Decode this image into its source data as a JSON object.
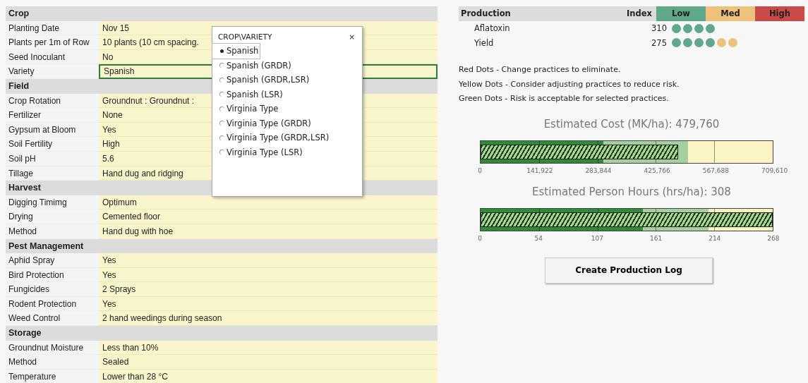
{
  "sections": [
    {
      "title": "Crop",
      "rows": [
        {
          "label": "Planting Date",
          "value": "Nov 15",
          "selected": false
        },
        {
          "label": "Plants per 1m of Row",
          "value": "10 plants (10 cm spacing.",
          "selected": false
        },
        {
          "label": "Seed Inoculant",
          "value": "No",
          "selected": false
        },
        {
          "label": "Variety",
          "value": "Spanish",
          "selected": true
        }
      ]
    },
    {
      "title": "Field",
      "rows": [
        {
          "label": "Crop Rotation",
          "value": "Groundnut : Groundnut :",
          "selected": false
        },
        {
          "label": "Fertilizer",
          "value": "None",
          "selected": false
        },
        {
          "label": "Gypsum at Bloom",
          "value": "Yes",
          "selected": false
        },
        {
          "label": "Soil Fertility",
          "value": "High",
          "selected": false
        },
        {
          "label": "Soil pH",
          "value": "5.6",
          "selected": false
        },
        {
          "label": "Tillage",
          "value": "Hand dug and ridging",
          "selected": false
        }
      ]
    },
    {
      "title": "Harvest",
      "rows": [
        {
          "label": "Digging Timimg",
          "value": "Optimum",
          "selected": false
        },
        {
          "label": "Drying",
          "value": "Cemented floor",
          "selected": false
        },
        {
          "label": "Method",
          "value": "Hand dug with hoe",
          "selected": false
        }
      ]
    },
    {
      "title": "Pest Management",
      "rows": [
        {
          "label": "Aphid Spray",
          "value": "Yes",
          "selected": false
        },
        {
          "label": "Bird Protection",
          "value": "Yes",
          "selected": false
        },
        {
          "label": "Fungicides",
          "value": "2 Sprays",
          "selected": false
        },
        {
          "label": "Rodent Protection",
          "value": "Yes",
          "selected": false
        },
        {
          "label": "Weed Control",
          "value": "2 hand weedings during season",
          "selected": false
        }
      ]
    },
    {
      "title": "Storage",
      "rows": [
        {
          "label": "Groundnut Moisture",
          "value": "Less than 10%",
          "selected": false
        },
        {
          "label": "Method",
          "value": "Sealed",
          "selected": false
        },
        {
          "label": "Temperature",
          "value": "Lower than 28 °C",
          "selected": false
        }
      ]
    }
  ],
  "popup": {
    "title": "CROP\\VARIETY",
    "close": "×",
    "options": [
      {
        "label": "Spanish",
        "selected": true
      },
      {
        "label": "Spanish (GRDR)",
        "selected": false
      },
      {
        "label": "Spanish (GRDR,LSR)",
        "selected": false
      },
      {
        "label": "Spanish (LSR)",
        "selected": false
      },
      {
        "label": "Virginia Type",
        "selected": false
      },
      {
        "label": "Virginia Type (GRDR)",
        "selected": false
      },
      {
        "label": "Virginia Type (GRDR,LSR)",
        "selected": false
      },
      {
        "label": "Virginia Type (LSR)",
        "selected": false
      }
    ]
  },
  "production": {
    "title": "Production",
    "index_header": "Index",
    "levels": [
      {
        "label": "Low",
        "color": "#5fa88a"
      },
      {
        "label": "Med",
        "color": "#eec27a"
      },
      {
        "label": "High",
        "color": "#c94a47"
      }
    ],
    "rows": [
      {
        "name": "Aflatoxin",
        "index": "310",
        "dots": [
          {
            "color": "#5fa88a"
          },
          {
            "color": "#5fa88a"
          },
          {
            "color": "#5fa88a"
          },
          {
            "color": "#5fa88a"
          }
        ]
      },
      {
        "name": "Yield",
        "index": "275",
        "dots": [
          {
            "color": "#5fa88a"
          },
          {
            "color": "#5fa88a"
          },
          {
            "color": "#5fa88a"
          },
          {
            "color": "#5fa88a"
          },
          {
            "color": "#eec27a"
          },
          {
            "color": "#eec27a"
          }
        ]
      }
    ]
  },
  "legend": [
    "Red Dots - Change practices to eliminate.",
    "Yellow Dots - Consider adjusting practices to reduce risk.",
    "Green Dots - Risk is acceptable for selected practices."
  ],
  "meters": [
    {
      "title": "Estimated Cost (MK/ha): 479,760",
      "level": 0.676,
      "bands": [
        {
          "level": 0.42
        },
        {
          "level": 0.71
        }
      ],
      "ticks": [
        "0",
        "141,922",
        "283,844",
        "425,766",
        "567,688",
        "709,610"
      ]
    },
    {
      "title": "Estimated Person Hours (hrs/ha): 308",
      "level": 1,
      "bands": [
        {
          "level": 0.555
        },
        {
          "level": 0.78
        }
      ],
      "ticks": [
        "0",
        "54",
        "107",
        "161",
        "214",
        "268"
      ]
    }
  ],
  "button": "Create Production Log"
}
